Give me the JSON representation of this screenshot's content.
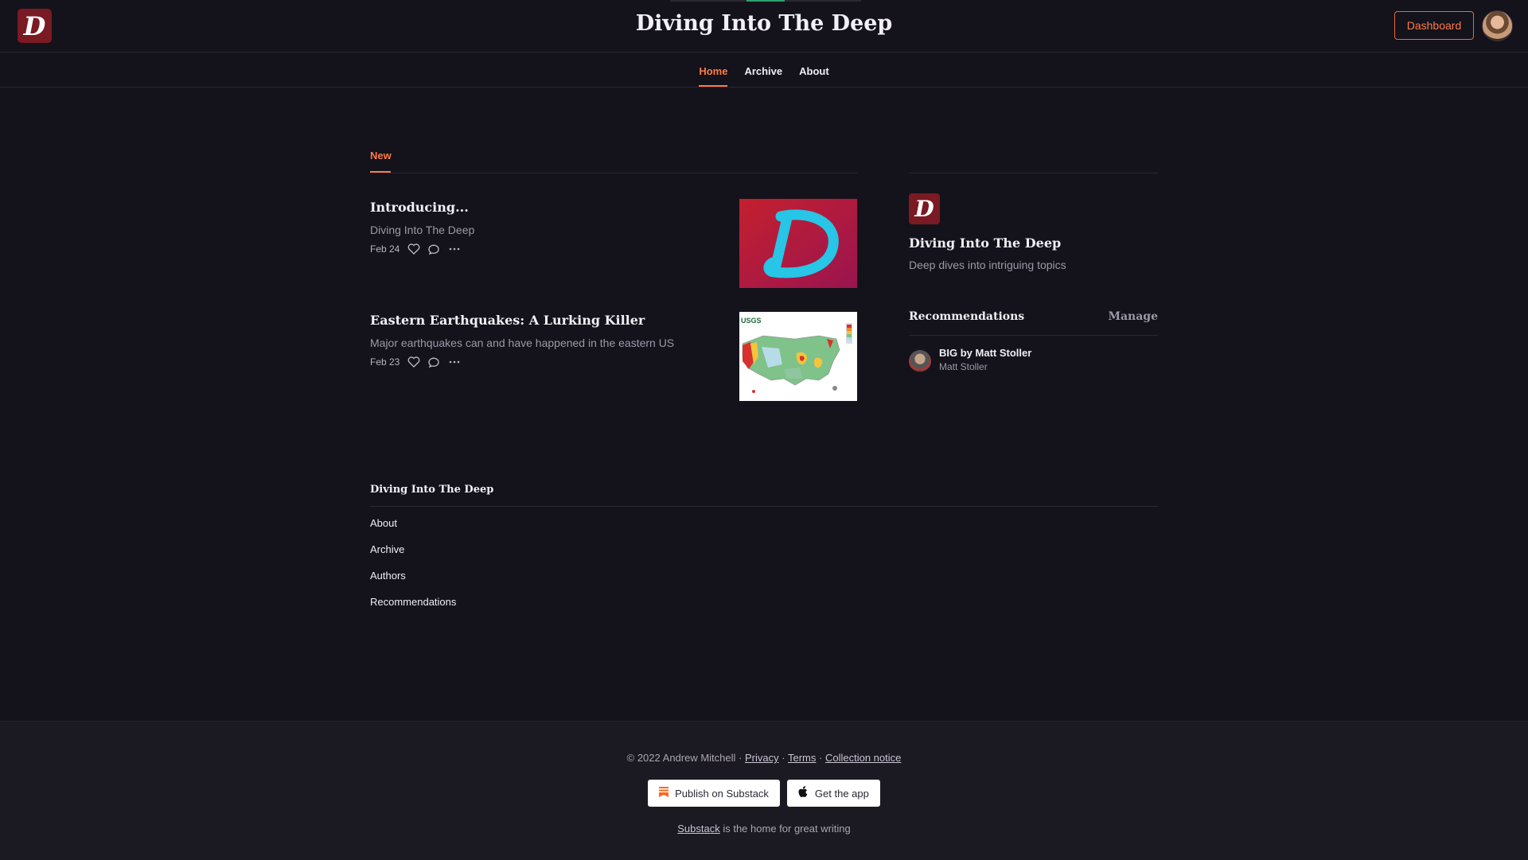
{
  "header": {
    "logo_letter": "D",
    "site_title": "Diving Into The Deep",
    "dashboard_label": "Dashboard",
    "accent_color": "#ff7a45",
    "logo_color": "#7a1a22"
  },
  "nav": {
    "items": [
      {
        "label": "Home",
        "active": true
      },
      {
        "label": "Archive",
        "active": false
      },
      {
        "label": "About",
        "active": false
      }
    ]
  },
  "feed": {
    "tab_label": "New",
    "posts": [
      {
        "title": "Introducing...",
        "subtitle": "Diving Into The Deep",
        "date": "Feb 24",
        "thumb": "red D logo"
      },
      {
        "title": "Eastern Earthquakes: A Lurking Killer",
        "subtitle": "Major earthquakes can and have happened in the eastern US",
        "date": "Feb 23",
        "thumb": "USGS hazard map",
        "thumb_label": "USGS"
      }
    ]
  },
  "sidebar": {
    "logo_letter": "D",
    "publication_name": "Diving Into The Deep",
    "description": "Deep dives into intriguing topics",
    "recommendations_title": "Recommendations",
    "manage_label": "Manage",
    "recommendations": [
      {
        "name": "BIG by Matt Stoller",
        "author": "Matt Stoller"
      }
    ]
  },
  "site_footer": {
    "title": "Diving Into The Deep",
    "links": [
      "About",
      "Archive",
      "Authors",
      "Recommendations"
    ]
  },
  "footer": {
    "copyright": "© 2022 Andrew Mitchell",
    "sep": "·",
    "privacy": "Privacy",
    "terms": "Terms",
    "collection_notice": "Collection notice",
    "publish_label": "Publish on Substack",
    "app_label": "Get the app",
    "substack_link": "Substack",
    "tagline_rest": "is the home for great writing"
  }
}
